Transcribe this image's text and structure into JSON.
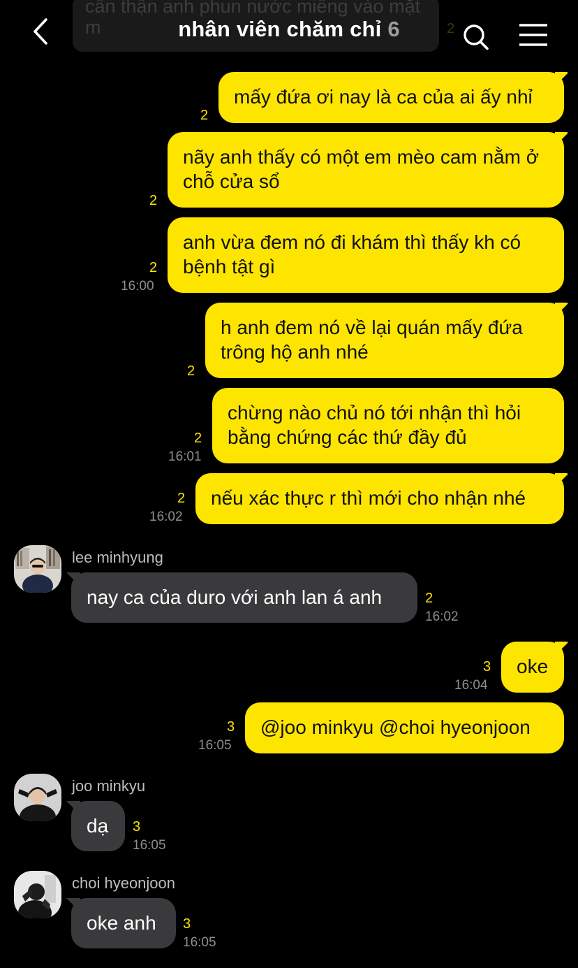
{
  "header": {
    "title": "nhân viên chăm chỉ",
    "member_count": "6"
  },
  "ghost": {
    "text": "cẩn thận anh phun nước miếng vào mặt m",
    "unread": "2"
  },
  "messages": [
    {
      "text": "mấy đứa ơi nay là ca của ai ấy nhỉ",
      "unread": "2"
    },
    {
      "text": "nãy anh thấy có một em mèo cam nằm ở chỗ cửa sổ",
      "unread": "2"
    },
    {
      "text": "anh vừa đem nó đi khám thì thấy kh có bệnh tật gì",
      "unread": "2",
      "time": "16:00"
    },
    {
      "text": "h anh đem nó về lại quán mấy đứa trông hộ anh nhé",
      "unread": "2"
    },
    {
      "text": "chừng nào chủ nó tới nhận thì hỏi bằng chứng các thứ đầy đủ",
      "unread": "2",
      "time": "16:01"
    },
    {
      "text": "nếu xác thực r thì mới cho nhận nhé",
      "unread": "2",
      "time": "16:02"
    },
    {
      "sender": "lee minhyung",
      "text": "nay ca của duro với anh lan á anh",
      "unread": "2",
      "time": "16:02"
    },
    {
      "text": "oke",
      "unread": "3",
      "time": "16:04"
    },
    {
      "text": "@joo minkyu @choi hyeonjoon",
      "unread": "3",
      "time": "16:05"
    },
    {
      "sender": "joo minkyu",
      "text": "dạ",
      "unread": "3",
      "time": "16:05"
    },
    {
      "sender": "choi hyeonjoon",
      "text": "oke anh",
      "unread": "3",
      "time": "16:05"
    }
  ],
  "icons": {
    "back": "chevron-left-icon",
    "search": "search-icon",
    "menu": "hamburger-menu-icon"
  },
  "colors": {
    "background": "#000000",
    "outgoing_bubble": "#fde500",
    "incoming_bubble": "#3a3a3c",
    "unread_count": "#fde500",
    "timestamp": "#8e8e8e"
  }
}
